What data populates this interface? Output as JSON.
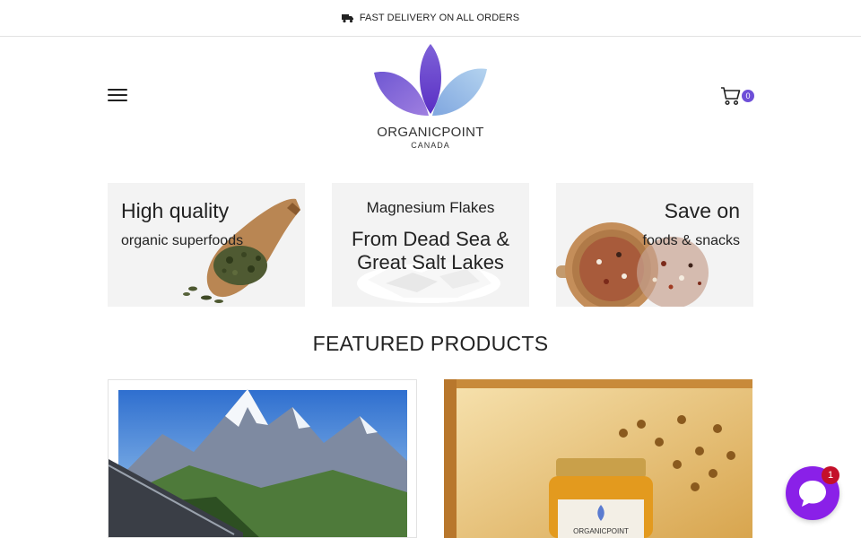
{
  "announcement": {
    "text": "FAST DELIVERY ON ALL ORDERS",
    "icon": "truck-icon"
  },
  "header": {
    "menu_icon": "hamburger-menu-icon",
    "logo": {
      "name": "ORGANICPOINT",
      "subtitle": "CANADA",
      "colors": [
        "#7b4fd6",
        "#9ec2e6"
      ]
    },
    "cart": {
      "icon": "cart-icon",
      "count": "0",
      "badge_color": "#6e4fd8"
    }
  },
  "promos": [
    {
      "title": "High quality",
      "subtitle": "organic superfoods"
    },
    {
      "title": "Magnesium Flakes",
      "subtitle": "From Dead Sea & Great Salt Lakes"
    },
    {
      "title": "Save on",
      "subtitle": "foods & snacks"
    }
  ],
  "featured": {
    "title": "FEATURED PRODUCTS",
    "products": [
      {
        "image": "mountain-landscape-image"
      },
      {
        "image": "honey-jar-image",
        "label": "ORGANICPOINT"
      }
    ]
  },
  "chat": {
    "icon": "chat-icon",
    "badge": "1",
    "color": "#8a20e8"
  }
}
